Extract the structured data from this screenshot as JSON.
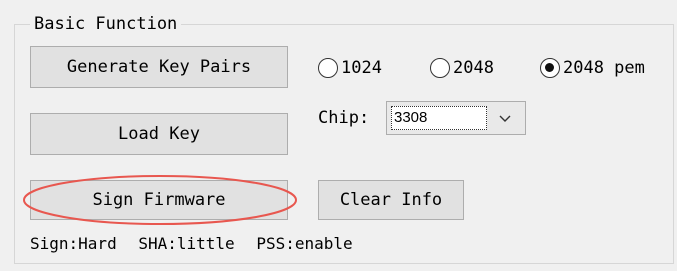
{
  "group": {
    "title": "Basic Function"
  },
  "buttons": {
    "generate": "Generate Key Pairs",
    "load": "Load Key",
    "sign": "Sign Firmware",
    "clear": "Clear Info"
  },
  "key_size": {
    "options": [
      "1024",
      "2048",
      "2048 pem"
    ],
    "selected": "2048 pem"
  },
  "chip": {
    "label": "Chip:",
    "value": "3308"
  },
  "status": {
    "sign": "Sign:Hard",
    "sha": "SHA:little",
    "pss": "PSS:enable"
  },
  "colors": {
    "annotation_ellipse": "#e8574f"
  }
}
